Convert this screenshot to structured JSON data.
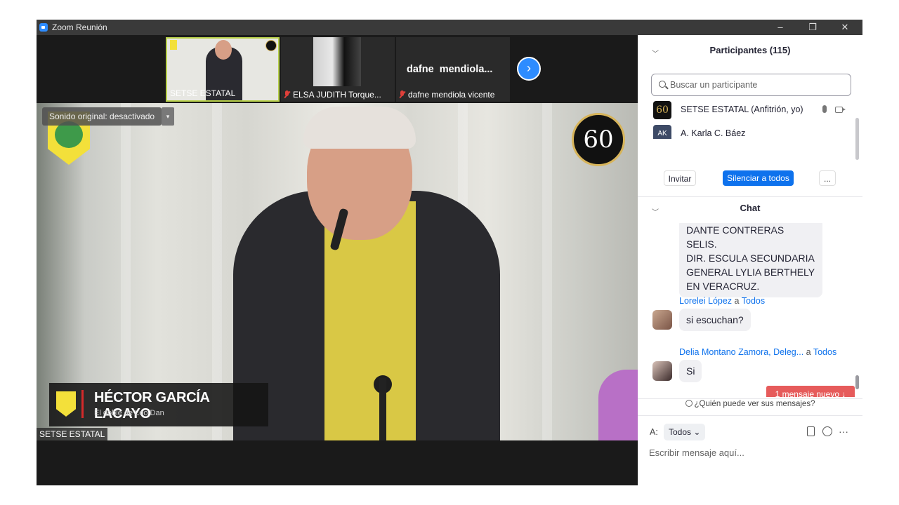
{
  "window": {
    "title": "Zoom Reunión",
    "minimize": "–",
    "restore": "❐",
    "close": "✕"
  },
  "thumbnails": [
    {
      "name": "SETSE ESTATAL",
      "muted": false,
      "active": true
    },
    {
      "name": "ELSA JUDITH Torque...",
      "muted": true,
      "active": false
    },
    {
      "name": "dafne mendiola vicente",
      "display": "dafne  mendiola...",
      "muted": true,
      "active": false
    }
  ],
  "main_video": {
    "audio_banner": "Sonido original: desactivado",
    "dropdown_glyph": "▾",
    "anniversary": "60",
    "lower_third": {
      "name": "HÉCTOR GARCÍA LACAYO",
      "subtitle": "El doble de Leo Dan"
    },
    "participant_name": "SETSE ESTATAL"
  },
  "next_glyph": "›",
  "participants": {
    "header": "Participantes (115)",
    "search_placeholder": "Buscar un participante",
    "list": [
      {
        "avatar": "60",
        "name": "SETSE ESTATAL (Anfitrión, yo)"
      },
      {
        "avatar": "AK",
        "name": "A. Karla C. Báez"
      }
    ],
    "invite": "Invitar",
    "mute_all": "Silenciar a todos",
    "more": "..."
  },
  "chat": {
    "header": "Chat",
    "messages": [
      {
        "sender": "",
        "to": "",
        "text_lines": [
          "DANTE  CONTRERAS SELIS.",
          "DIR. ESCULA SECUNDARIA",
          "GENERAL LYLIA BERTHELY",
          "EN VERACRUZ."
        ]
      },
      {
        "sender": "Lorelei López",
        "connector": "a",
        "to": "Todos",
        "text": "si escuchan?"
      },
      {
        "sender": "Delia Montano Zamora, Deleg...",
        "connector": "a",
        "to": "Todos",
        "text": "Si"
      }
    ],
    "new_message": "1 mensaje nuevo ↓",
    "who_sees": "¿Quién puede ver sus mensajes?",
    "to_label": "A:",
    "to_value": "Todos",
    "to_chevron": "⌄",
    "more_icon": "···",
    "input_placeholder": "Escribir mensaje aquí..."
  },
  "colors": {
    "accent": "#0e72ed",
    "new_msg": "#e65b5b",
    "active_border": "#b8d04a"
  }
}
